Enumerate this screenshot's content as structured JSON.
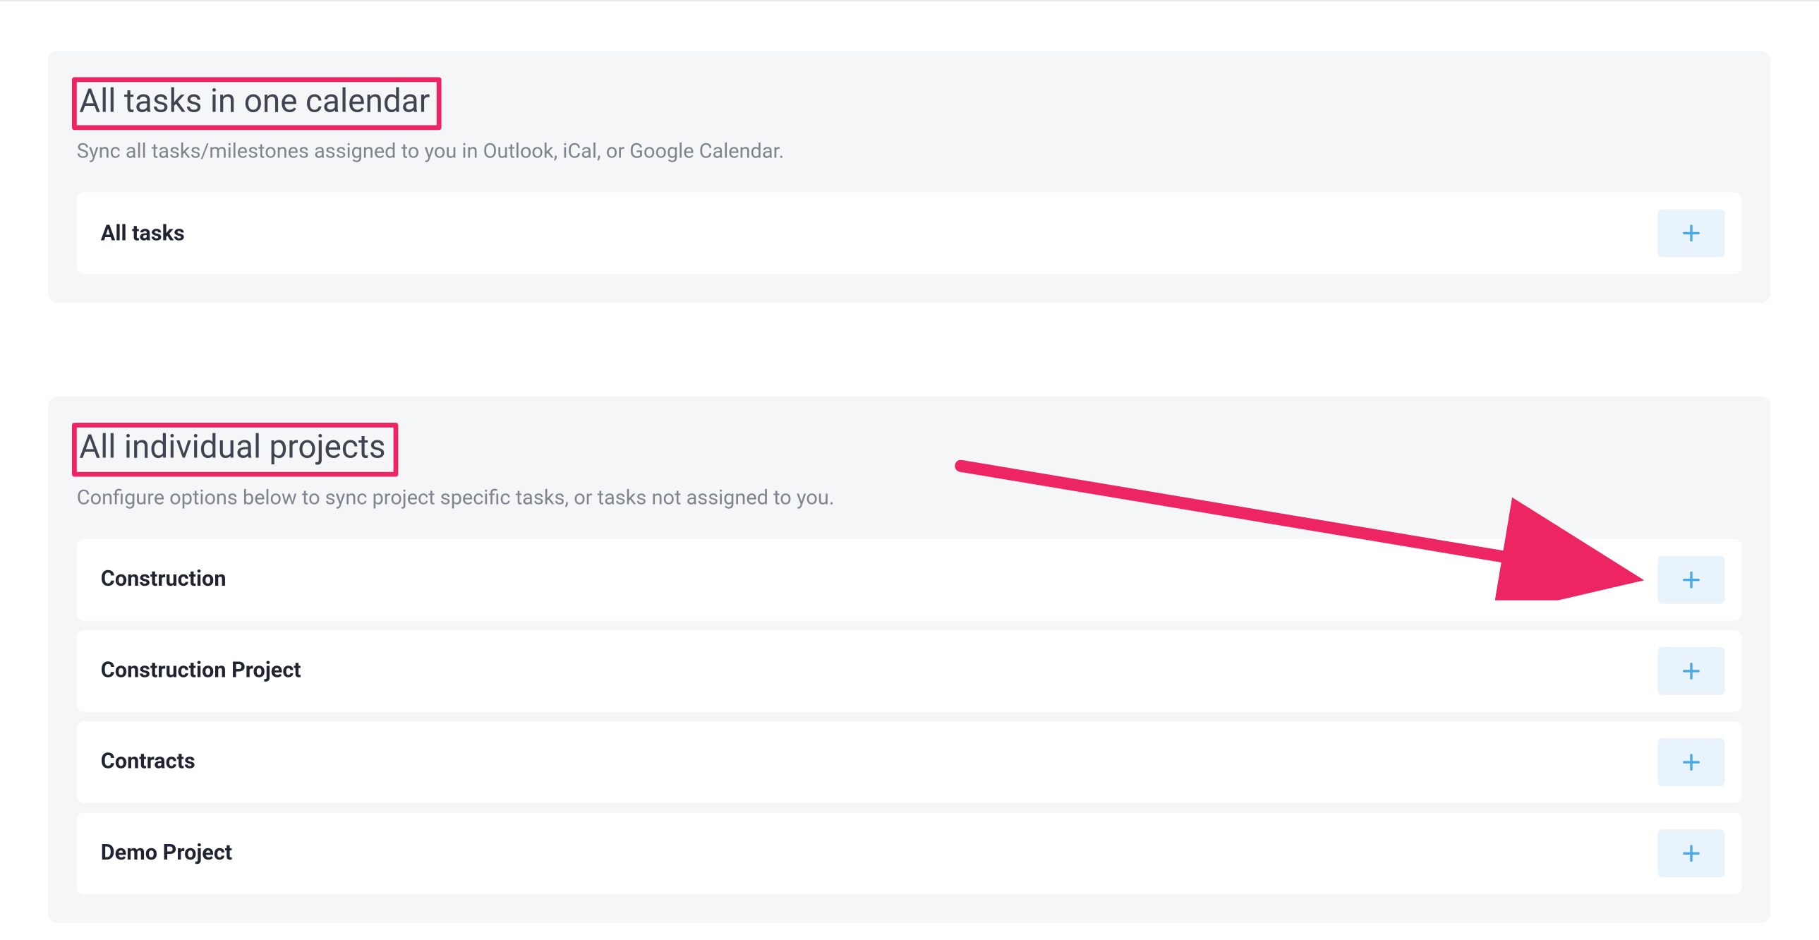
{
  "sections": {
    "all_tasks": {
      "title": "All tasks in one calendar",
      "subtitle": "Sync all tasks/milestones assigned to you in Outlook, iCal, or Google Calendar.",
      "rows": [
        {
          "label": "All tasks"
        }
      ]
    },
    "projects": {
      "title": "All individual projects",
      "subtitle": "Configure options below to sync project specific tasks, or tasks not assigned to you.",
      "rows": [
        {
          "label": "Construction"
        },
        {
          "label": "Construction Project"
        },
        {
          "label": "Contracts"
        },
        {
          "label": "Demo Project"
        }
      ]
    }
  },
  "annotation": {
    "highlight_color": "#ed2563"
  }
}
